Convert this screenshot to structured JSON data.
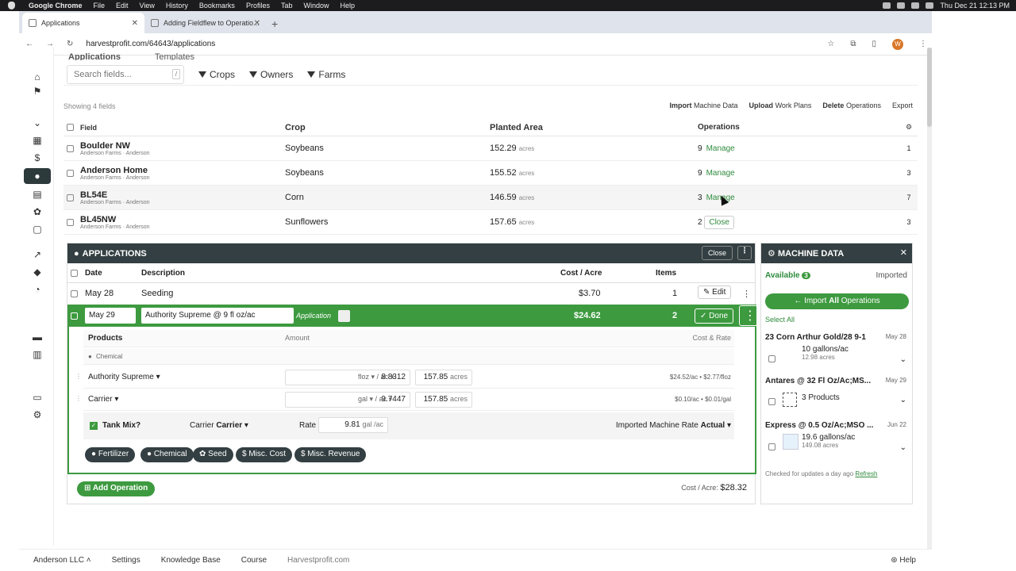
{
  "macbar": {
    "app": "Google Chrome",
    "menus": [
      "File",
      "Edit",
      "View",
      "History",
      "Bookmarks",
      "Profiles",
      "Tab",
      "Window",
      "Help"
    ],
    "clock": "Thu Dec 21 12:13 PM"
  },
  "browser": {
    "tabs": [
      {
        "label": "Applications"
      },
      {
        "label": "Adding Fieldflew to Operatio..."
      }
    ],
    "url": "harvestprofit.com/64643/applications",
    "avatar": "W"
  },
  "subtabs": {
    "applications": "Applications",
    "templates": "Templates"
  },
  "filters": {
    "search_placeholder": "Search fields...",
    "search_key": "/",
    "crops": "Crops",
    "owners": "Owners",
    "farms": "Farms"
  },
  "showing": "Showing 4 fields",
  "actions": {
    "import_b": "Import",
    "import": "Machine Data",
    "upload_b": "Upload",
    "upload": "Work Plans",
    "delete_b": "Delete",
    "delete": "Operations",
    "export": "Export"
  },
  "table": {
    "headers": {
      "field": "Field",
      "crop": "Crop",
      "area": "Planted Area",
      "ops": "Operations"
    },
    "rows": [
      {
        "field": "Boulder NW",
        "farm": "Anderson Farms",
        "owner": "Anderson",
        "crop": "Soybeans",
        "area": "152.29",
        "unit": "acres",
        "ops": "9",
        "link": "Manage",
        "n": "1"
      },
      {
        "field": "Anderson Home",
        "farm": "Anderson Farms",
        "owner": "Anderson",
        "crop": "Soybeans",
        "area": "155.52",
        "unit": "acres",
        "ops": "9",
        "link": "Manage",
        "n": "3"
      },
      {
        "field": "BL54E",
        "farm": "Anderson Farms",
        "owner": "Anderson",
        "crop": "Corn",
        "area": "146.59",
        "unit": "acres",
        "ops": "3",
        "link": "Manage",
        "n": "7"
      },
      {
        "field": "BL45NW",
        "farm": "Anderson Farms",
        "owner": "Anderson",
        "crop": "Sunflowers",
        "area": "157.65",
        "unit": "acres",
        "ops": "2",
        "link": "Close",
        "n": "3"
      }
    ]
  },
  "apps": {
    "title": "APPLICATIONS",
    "close": "Close",
    "menu": "⋮",
    "headers": {
      "date": "Date",
      "desc": "Description",
      "cost": "Cost / Acre",
      "items": "Items"
    },
    "row1": {
      "date": "May 28",
      "desc": "Seeding",
      "cost": "$3.70",
      "items": "1",
      "edit": "Edit"
    },
    "row2": {
      "date": "May 29",
      "desc": "Authority Supreme @ 9 fl oz/ac",
      "type": "Application",
      "cost": "$24.62",
      "items": "2",
      "done": "Done"
    },
    "products_h": {
      "products": "Products",
      "amount": "Amount",
      "cost_rate": "Cost & Rate",
      "category": "Chemical"
    },
    "products": [
      {
        "name": "Authority Supreme",
        "amount": "8.8312",
        "unit": "floz",
        "per": "/ ac",
        "acres": "157.85",
        "acres_u": "acres",
        "cost": "$24.52/ac • $2.77/floz"
      },
      {
        "name": "Carrier",
        "amount": "9.7447",
        "unit": "gal",
        "per": "/ ac",
        "acres": "157.85",
        "acres_u": "acres",
        "cost": "$0.10/ac • $0.01/gal"
      }
    ],
    "tank": {
      "label": "Tank Mix?",
      "carrier_l": "Carrier",
      "carrier_v": "Carrier",
      "rate_l": "Rate",
      "rate_v": "9.81",
      "rate_u": "gal",
      "rate_per": "/ac",
      "imported_l": "Imported Machine Rate",
      "imported_v": "Actual"
    },
    "pills": [
      "Fertilizer",
      "Chemical",
      "Seed",
      "Misc. Cost",
      "Misc. Revenue"
    ],
    "add_op": "Add Operation",
    "cost_l": "Cost / Acre:",
    "cost_v": "$28.32"
  },
  "machine": {
    "title": "MACHINE DATA",
    "available": "Available",
    "avail_count": "3",
    "imported": "Imported",
    "import_all_a": "Import",
    "import_all_b": "All",
    "import_all_c": "Operations",
    "select_all": "Select All",
    "items": [
      {
        "title": "23 Corn Arthur Gold/28 9-1",
        "date": "May 28",
        "line": "10 gallons/ac",
        "sub": "12.98 acres"
      },
      {
        "title": "Antares @ 32 Fl Oz/Ac;MS...",
        "date": "May 29",
        "line": "3 Products",
        "sub": ""
      },
      {
        "title": "Express @ 0.5 Oz/Ac;MSO ...",
        "date": "Jun 22",
        "line": "19.6 gallons/ac",
        "sub": "149.08 acres"
      }
    ],
    "checked": "Checked for updates a day ago",
    "refresh": "Refresh"
  },
  "footer": {
    "org": "Anderson LLC",
    "settings": "Settings",
    "kb": "Knowledge Base",
    "course": "Course",
    "site": "Harvestprofit.com",
    "help": "Help"
  }
}
